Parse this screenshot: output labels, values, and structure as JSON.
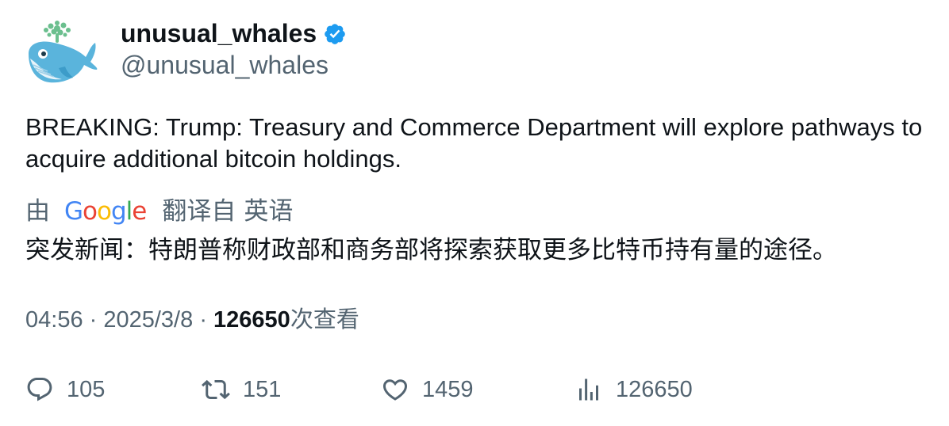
{
  "author": {
    "display_name": "unusual_whales",
    "handle": "@unusual_whales",
    "verified": true,
    "avatar_icon": "whale-avatar-icon",
    "verified_color": "#1d9bf0"
  },
  "tweet": {
    "text": "BREAKING: Trump: Treasury and Commerce Department will explore pathways to acquire additional bitcoin holdings."
  },
  "translation": {
    "by_label": "由",
    "provider": "Google",
    "from_label": "翻译自",
    "language": "英语",
    "text": "突发新闻：特朗普称财政部和商务部将探索获取更多比特币持有量的途径。"
  },
  "meta": {
    "time": "04:56",
    "separator": "·",
    "date": "2025/3/8",
    "views_count": "126650",
    "views_suffix": "次查看"
  },
  "actions": {
    "replies": "105",
    "retweets": "151",
    "likes": "1459",
    "views": "126650"
  },
  "colors": {
    "text_primary": "#0f1419",
    "text_secondary": "#536471",
    "google_blue": "#4285F4",
    "google_red": "#EA4335",
    "google_yellow": "#FBBC05",
    "google_green": "#34A853"
  }
}
